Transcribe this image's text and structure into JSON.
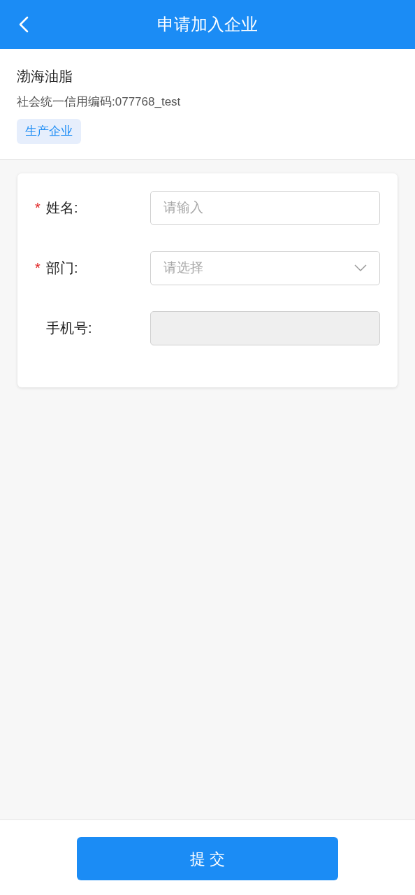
{
  "header": {
    "title": "申请加入企业"
  },
  "company": {
    "name": "渤海油脂",
    "credit_code": "社会统一信用编码:077768_test",
    "tag": "生产企业"
  },
  "form": {
    "fields": [
      {
        "kind": "input",
        "required_mark": "*",
        "label": "姓名:",
        "placeholder": "请输入",
        "disabled": false
      },
      {
        "kind": "select",
        "required_mark": "*",
        "label": "部门:",
        "placeholder": "请选择",
        "disabled": false
      },
      {
        "kind": "input",
        "label": "手机号:",
        "disabled": true
      }
    ]
  },
  "submit_button": "提 交"
}
